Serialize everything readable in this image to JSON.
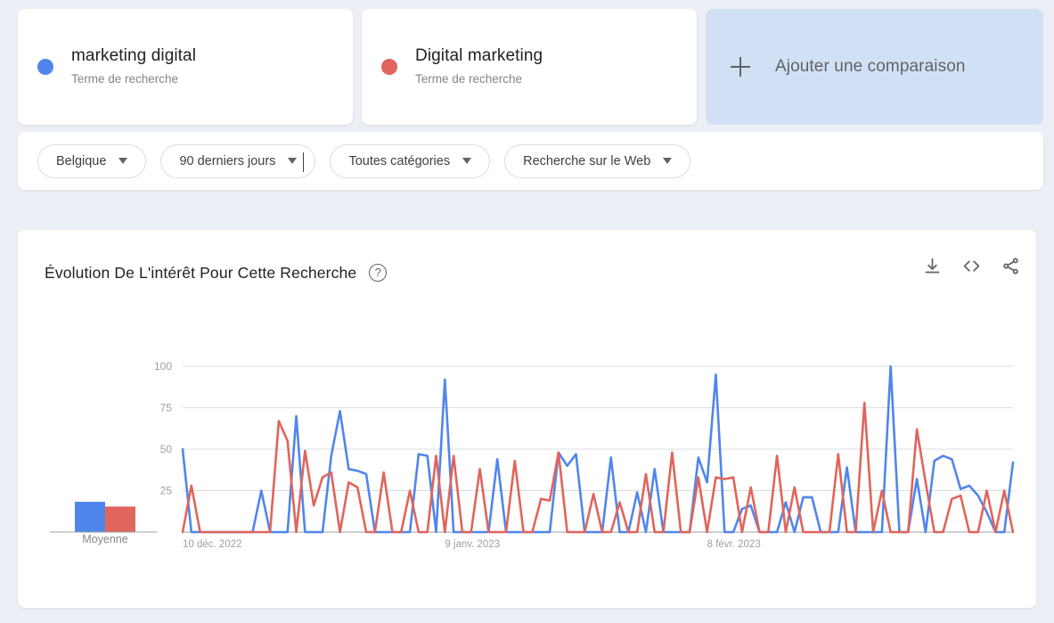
{
  "terms": [
    {
      "name": "marketing digital",
      "subtitle": "Terme de recherche",
      "color": "#5086EC"
    },
    {
      "name": "Digital marketing",
      "subtitle": "Terme de recherche",
      "color": "#E0655C"
    }
  ],
  "add_comparison": {
    "label": "Ajouter une comparaison",
    "icon": "plus-icon"
  },
  "filters": [
    {
      "label": "Belgique",
      "icon": "chevron-down-icon"
    },
    {
      "label": "90 derniers jours",
      "icon": "chevron-down-icon"
    },
    {
      "label": "Toutes catégories",
      "icon": "chevron-down-icon"
    },
    {
      "label": "Recherche sur le Web",
      "icon": "chevron-down-icon"
    }
  ],
  "chart_card": {
    "title": "Évolution De L'intérêt Pour Cette Recherche",
    "help_icon": "help-circle-icon",
    "actions": [
      {
        "name": "download-icon"
      },
      {
        "name": "embed-code-icon"
      },
      {
        "name": "share-icon"
      }
    ],
    "average_label": "Moyenne"
  },
  "chart_data": {
    "type": "line",
    "title": "Évolution De L'intérêt Pour Cette Recherche",
    "xlabel": "",
    "ylabel": "",
    "ylim": [
      0,
      100
    ],
    "yticks": [
      25,
      50,
      75,
      100
    ],
    "ytick_labels": [
      "25",
      "50",
      "75",
      "100"
    ],
    "grid": true,
    "legend_position": "top-cards",
    "x_tick_labels": [
      "10 déc. 2022",
      "9 janv. 2023",
      "8 févr. 2023"
    ],
    "x_tick_positions": [
      0,
      30,
      60
    ],
    "n_points": 91,
    "averages": {
      "marketing digital": 19,
      "Digital marketing": 16
    },
    "series": [
      {
        "name": "marketing digital",
        "color": "#5086EC",
        "values": [
          50,
          0,
          0,
          0,
          0,
          0,
          0,
          0,
          0,
          25,
          0,
          0,
          0,
          70,
          0,
          0,
          0,
          46,
          73,
          38,
          37,
          35,
          0,
          0,
          0,
          0,
          0,
          47,
          46,
          0,
          92,
          0,
          0,
          0,
          0,
          0,
          44,
          0,
          0,
          0,
          0,
          0,
          0,
          48,
          40,
          47,
          0,
          0,
          0,
          45,
          0,
          0,
          24,
          0,
          38,
          0,
          0,
          0,
          0,
          45,
          30,
          95,
          0,
          0,
          14,
          16,
          0,
          0,
          0,
          18,
          0,
          21,
          21,
          0,
          0,
          0,
          39,
          0,
          0,
          0,
          0,
          100,
          0,
          0,
          32,
          0,
          43,
          46,
          44,
          26,
          28,
          22,
          12,
          0,
          0,
          42
        ]
      },
      {
        "name": "Digital marketing",
        "color": "#E0655C",
        "values": [
          0,
          28,
          0,
          0,
          0,
          0,
          0,
          0,
          0,
          0,
          0,
          67,
          55,
          0,
          49,
          16,
          33,
          36,
          0,
          30,
          27,
          0,
          0,
          36,
          0,
          0,
          25,
          0,
          0,
          46,
          0,
          46,
          0,
          0,
          38,
          0,
          0,
          0,
          43,
          0,
          0,
          20,
          19,
          48,
          0,
          0,
          0,
          23,
          0,
          0,
          18,
          0,
          0,
          35,
          0,
          0,
          48,
          0,
          0,
          33,
          0,
          33,
          32,
          33,
          0,
          27,
          0,
          0,
          46,
          0,
          27,
          0,
          0,
          0,
          0,
          47,
          0,
          0,
          78,
          0,
          25,
          0,
          0,
          0,
          62,
          30,
          0,
          0,
          20,
          22,
          0,
          0,
          25,
          0,
          25,
          0
        ]
      }
    ]
  }
}
